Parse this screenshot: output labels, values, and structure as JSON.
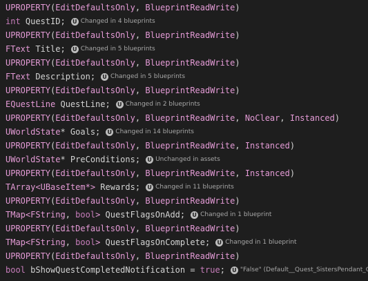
{
  "colors": {
    "background": "#1e1e1e",
    "macro": "#e49bd6",
    "keyword": "#c77dbb",
    "text": "#d4d4d4",
    "hint": "#a8a8a8"
  },
  "hint_icon": "unreal-engine-icon",
  "lines": [
    {
      "macro": "UPROPERTY",
      "args": [
        "EditDefaultsOnly",
        "BlueprintReadWrite"
      ]
    },
    {
      "type": "int",
      "rest": " QuestID;",
      "hint": "Changed in 4 blueprints"
    },
    {
      "macro": "UPROPERTY",
      "args": [
        "EditDefaultsOnly",
        "BlueprintReadWrite"
      ]
    },
    {
      "type": "FText",
      "rest": " Title;",
      "hint": "Changed in 5 blueprints"
    },
    {
      "macro": "UPROPERTY",
      "args": [
        "EditDefaultsOnly",
        "BlueprintReadWrite"
      ]
    },
    {
      "type": "FText",
      "rest": " Description;",
      "hint": "Changed in 5 blueprints"
    },
    {
      "macro": "UPROPERTY",
      "args": [
        "EditDefaultsOnly",
        "BlueprintReadWrite"
      ]
    },
    {
      "type": "EQuestLine",
      "rest": " QuestLine;",
      "hint": "Changed in 2 blueprints"
    },
    {
      "macro": "UPROPERTY",
      "args": [
        "EditDefaultsOnly",
        "BlueprintReadWrite",
        "NoClear",
        "Instanced"
      ]
    },
    {
      "type": "UWorldState",
      "rest": "* Goals;",
      "hint": "Changed in 14 blueprints"
    },
    {
      "macro": "UPROPERTY",
      "args": [
        "EditDefaultsOnly",
        "BlueprintReadWrite",
        "Instanced"
      ]
    },
    {
      "type": "UWorldState",
      "rest": "* PreConditions;",
      "hint": "Unchanged in assets"
    },
    {
      "macro": "UPROPERTY",
      "args": [
        "EditDefaultsOnly",
        "BlueprintReadWrite",
        "Instanced"
      ]
    },
    {
      "type": "TArray<UBaseItem*>",
      "rest": " Rewards;",
      "hint": "Changed in 11 blueprints"
    },
    {
      "macro": "UPROPERTY",
      "args": [
        "EditDefaultsOnly",
        "BlueprintReadWrite"
      ]
    },
    {
      "type": "TMap<FString, bool>",
      "rest": " QuestFlagsOnAdd;",
      "hint": "Changed in 1 blueprint"
    },
    {
      "macro": "UPROPERTY",
      "args": [
        "EditDefaultsOnly",
        "BlueprintReadWrite"
      ]
    },
    {
      "type": "TMap<FString, bool>",
      "rest": " QuestFlagsOnComplete;",
      "hint": "Changed in 1 blueprint"
    },
    {
      "macro": "UPROPERTY",
      "args": [
        "EditDefaultsOnly",
        "BlueprintReadWrite"
      ]
    },
    {
      "type": "bool",
      "rest": " bShowQuestCompletedNotification = ",
      "value": "true",
      "tail": ";",
      "hint": "\"False\" (Default__Quest_SistersPendant_C)"
    }
  ]
}
